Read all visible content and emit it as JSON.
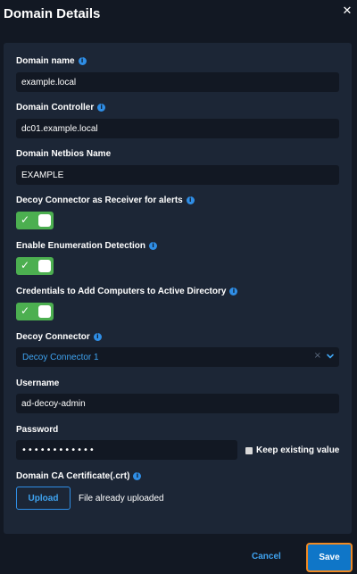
{
  "dialog": {
    "title": "Domain Details",
    "close_icon": "✕"
  },
  "fields": {
    "domain_name": {
      "label": "Domain name",
      "value": "example.local"
    },
    "domain_controller": {
      "label": "Domain Controller",
      "value": "dc01.example.local"
    },
    "netbios_name": {
      "label": "Domain Netbios Name",
      "value": "EXAMPLE"
    },
    "decoy_receiver": {
      "label": "Decoy Connector as Receiver for alerts",
      "checked": true
    },
    "enumeration_detection": {
      "label": "Enable Enumeration Detection",
      "checked": true
    },
    "add_computers": {
      "label": "Credentials to Add Computers to Active Directory",
      "checked": true
    },
    "decoy_connector": {
      "label": "Decoy Connector",
      "selected": "Decoy Connector 1"
    },
    "username": {
      "label": "Username",
      "value": "ad-decoy-admin"
    },
    "password": {
      "label": "Password",
      "value": "************",
      "keep_existing_label": "Keep existing value"
    },
    "ca_certificate": {
      "label": "Domain CA Certificate(.crt)",
      "upload_label": "Upload",
      "status": "File already uploaded"
    }
  },
  "footer": {
    "cancel_label": "Cancel",
    "save_label": "Save"
  },
  "icons": {
    "info": "i",
    "check": "✓",
    "clear": "×"
  },
  "colors": {
    "background": "#121823",
    "panel": "#1c2636",
    "accent": "#2f8ee6",
    "toggle_on": "#4caf50",
    "save_border": "#f08a24"
  }
}
